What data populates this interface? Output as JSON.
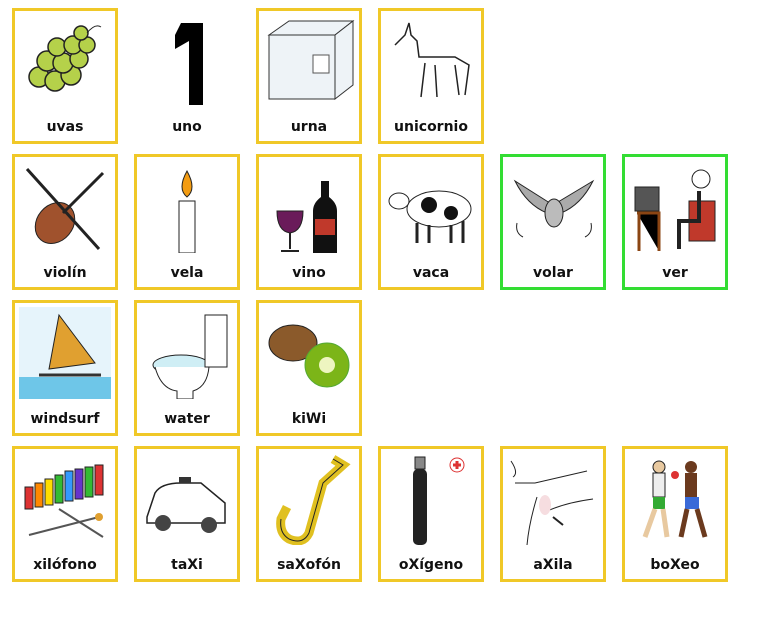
{
  "colors": {
    "yellow_border": "#f0c828",
    "green_border": "#33dd33"
  },
  "rows": [
    [
      {
        "label": "uvas",
        "icon": "grapes-icon",
        "border": "yellow"
      },
      {
        "label": "uno",
        "icon": "number-one-icon",
        "border": "none"
      },
      {
        "label": "urna",
        "icon": "ballot-box-icon",
        "border": "yellow"
      },
      {
        "label": "unicornio",
        "icon": "unicorn-icon",
        "border": "yellow"
      }
    ],
    [
      {
        "label": "violín",
        "icon": "violin-icon",
        "border": "yellow"
      },
      {
        "label": "vela",
        "icon": "candle-icon",
        "border": "yellow"
      },
      {
        "label": "vino",
        "icon": "wine-icon",
        "border": "yellow"
      },
      {
        "label": "vaca",
        "icon": "cow-icon",
        "border": "yellow"
      },
      {
        "label": "volar",
        "icon": "flying-bird-icon",
        "border": "green"
      },
      {
        "label": "ver",
        "icon": "watching-tv-icon",
        "border": "green"
      }
    ],
    [
      {
        "label": "windsurf",
        "icon": "windsurf-icon",
        "border": "yellow"
      },
      {
        "label": "water",
        "icon": "toilet-icon",
        "border": "yellow"
      },
      {
        "label": "kiWi",
        "icon": "kiwi-icon",
        "border": "yellow"
      }
    ],
    [
      {
        "label": "xilófono",
        "icon": "xylophone-icon",
        "border": "yellow"
      },
      {
        "label": "taXi",
        "icon": "taxi-icon",
        "border": "yellow"
      },
      {
        "label": "saXofón",
        "icon": "saxophone-icon",
        "border": "yellow"
      },
      {
        "label": "oXígeno",
        "icon": "oxygen-tank-icon",
        "border": "yellow"
      },
      {
        "label": "aXila",
        "icon": "armpit-icon",
        "border": "yellow"
      },
      {
        "label": "boXeo",
        "icon": "boxing-icon",
        "border": "yellow"
      }
    ]
  ]
}
